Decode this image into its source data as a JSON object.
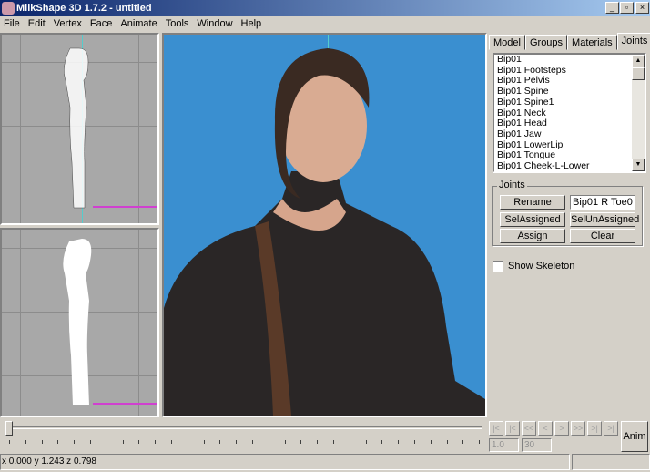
{
  "window": {
    "title": "MilkShape 3D 1.7.2 - untitled",
    "minimize": "_",
    "maximize": "▫",
    "close": "×"
  },
  "menu": [
    "File",
    "Edit",
    "Vertex",
    "Face",
    "Animate",
    "Tools",
    "Window",
    "Help"
  ],
  "tabs": [
    {
      "label": "Model"
    },
    {
      "label": "Groups"
    },
    {
      "label": "Materials"
    },
    {
      "label": "Joints",
      "active": true
    }
  ],
  "joints_list": [
    "Bip01",
    "Bip01 Footsteps",
    "Bip01 Pelvis",
    "Bip01 Spine",
    "Bip01 Spine1",
    "Bip01 Neck",
    "Bip01 Head",
    "Bip01 Jaw",
    "Bip01 LowerLip",
    "Bip01 Tongue",
    "Bip01 Cheek-L-Lower"
  ],
  "joints_group": {
    "label": "Joints",
    "rename": "Rename",
    "name_value": "Bip01 R Toe0",
    "sel_assigned": "SelAssigned",
    "sel_unassigned": "SelUnAssigned",
    "assign": "Assign",
    "clear": "Clear"
  },
  "show_skeleton": {
    "label": "Show Skeleton",
    "checked": false
  },
  "playback": {
    "buttons": [
      "|<",
      "|<",
      "<<",
      "<",
      ">",
      ">>",
      ">|",
      ">|"
    ],
    "start_frame": "1.0",
    "end_frame": "30",
    "anim": "Anim"
  },
  "status": {
    "coords": "x 0.000 y 1.243 z 0.798"
  },
  "colors": {
    "viewport_bg": "#3a8fd0",
    "title_start": "#0a246a"
  }
}
